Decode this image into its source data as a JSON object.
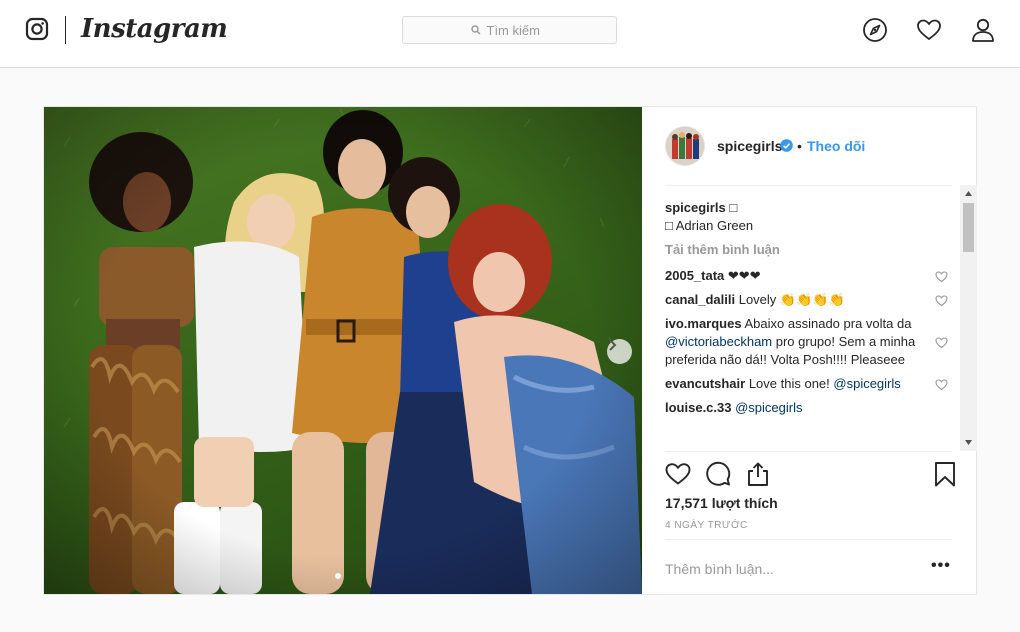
{
  "app": {
    "brand": "Instagram"
  },
  "search": {
    "placeholder": "Tìm kiếm"
  },
  "icons": {
    "nav": [
      "compass-icon",
      "heart-icon",
      "profile-icon"
    ],
    "post_actions": [
      "heart-icon",
      "comment-bubble-icon",
      "share-icon",
      "bookmark-icon"
    ]
  },
  "post": {
    "author": "spicegirls",
    "verified": true,
    "follow_label": "Theo dõi",
    "separator": "•",
    "caption": {
      "user": "spicegirls",
      "text": "",
      "credit": "Adrian Green"
    },
    "load_more_label": "Tải thêm bình luận",
    "comments": [
      {
        "user": "2005_tata",
        "text": "❤❤❤",
        "parts": []
      },
      {
        "user": "canal_dalili",
        "text": "Lovely 👏👏👏👏"
      },
      {
        "user": "ivo.marques",
        "before": "Abaixo assinado pra volta da ",
        "mention": "@victoriabeckham",
        "after": " pro grupo! Sem a minha preferida não dá!! Volta Posh!!!! Pleaseee"
      },
      {
        "user": "evancutshair",
        "before": "Love this one! ",
        "mention": "@spicegirls",
        "after": ""
      },
      {
        "user": "louise.c.33",
        "before": "",
        "mention": "@spicegirls",
        "after": ""
      }
    ],
    "likes_label": "17,571 lượt thích",
    "timestamp": "4 NGÀY TRƯỚC",
    "add_comment_placeholder": "Thêm bình luận...",
    "more_label": "•••",
    "carousel": {
      "current_index": 1,
      "has_next": true
    }
  },
  "colors": {
    "link_blue": "#3897f0",
    "mention_blue": "#003569",
    "verified_blue": "#3897f0",
    "muted_text": "#999999",
    "border": "#dbdbdb"
  }
}
